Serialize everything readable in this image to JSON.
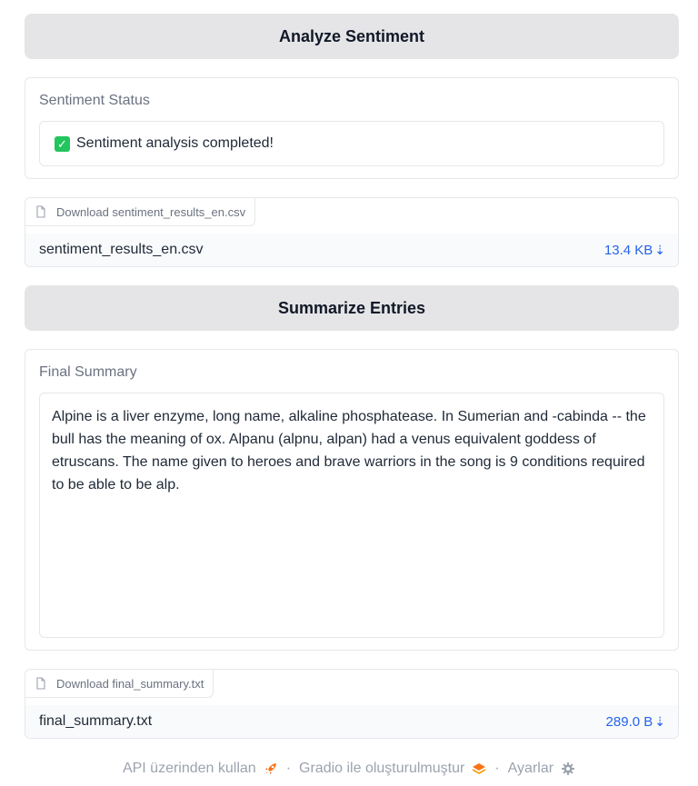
{
  "sentiment": {
    "button_label": "Analyze Sentiment",
    "status_label": "Sentiment Status",
    "status_text": "Sentiment analysis completed!",
    "status_icon": "check-mark-icon"
  },
  "sentiment_file": {
    "tab_label": "Download sentiment_results_en.csv",
    "file_name": "sentiment_results_en.csv",
    "file_size": "13.4 KB"
  },
  "summary": {
    "button_label": "Summarize Entries",
    "label": "Final Summary",
    "text": "Alpine is a liver enzyme, long name, alkaline phosphatease. In Sumerian and -cabinda -- the bull has the meaning of ox. Alpanu (alpnu, alpan) had a venus equivalent goddess of etruscans. The name given to heroes and brave warriors in the song is 9 conditions required to be able to be alp."
  },
  "summary_file": {
    "tab_label": "Download final_summary.txt",
    "file_name": "final_summary.txt",
    "file_size": "289.0 B"
  },
  "footer": {
    "api_label": "API üzerinden kullan",
    "gradio_label": "Gradio ile oluşturulmuştur",
    "settings_label": "Ayarlar",
    "separator": "·",
    "icons": [
      "rocket-icon",
      "gradio-logo-icon",
      "gear-icon"
    ]
  },
  "colors": {
    "button_bg": "#e5e5e7",
    "link_blue": "#2563eb",
    "muted_text": "#6b7280",
    "check_green": "#22c55e"
  }
}
